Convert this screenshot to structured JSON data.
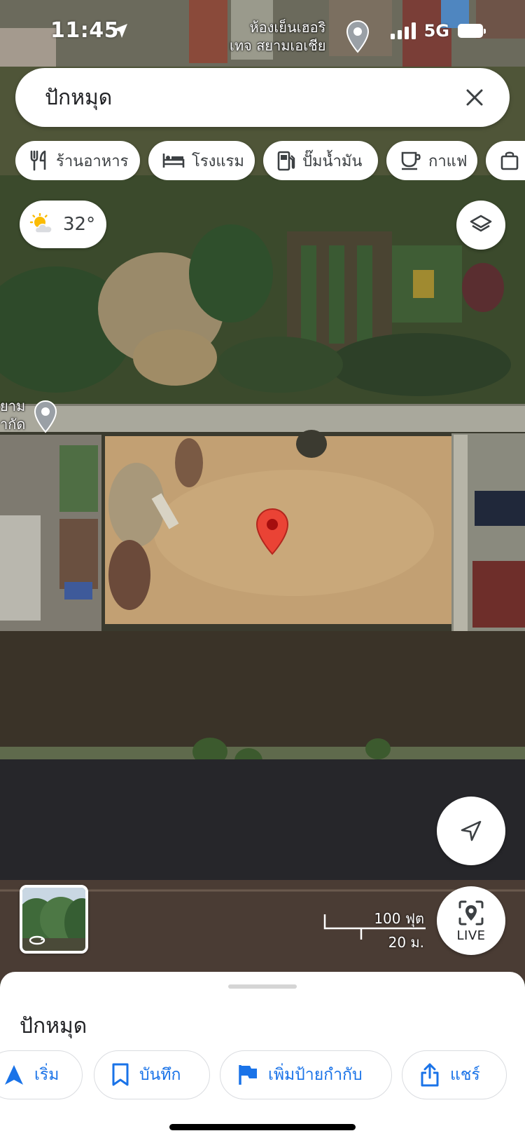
{
  "status_bar": {
    "time": "11:45",
    "network": "5G"
  },
  "map_labels": {
    "place_top_line1": "ห้องเย็นเฮอริ",
    "place_top_line2": "เทจ สยามเอเชีย",
    "place_left_line1": "ยาม",
    "place_left_line2": "ากัด"
  },
  "search": {
    "text": "ปักหมุด"
  },
  "chips": [
    {
      "label": "ร้านอาหาร",
      "icon": "restaurant-icon"
    },
    {
      "label": "โรงแรม",
      "icon": "hotel-icon"
    },
    {
      "label": "ปั๊มน้ำมัน",
      "icon": "gas-station-icon"
    },
    {
      "label": "กาแฟ",
      "icon": "coffee-icon"
    }
  ],
  "weather": {
    "temperature": "32°",
    "icon": "partly-cloudy-icon"
  },
  "live_button": {
    "label": "LIVE"
  },
  "scale": {
    "imperial": "100 ฟุต",
    "metric": "20 ม."
  },
  "sheet": {
    "title": "ปักหมุด",
    "actions": [
      {
        "label": "เริ่ม",
        "icon": "navigation-arrow-icon"
      },
      {
        "label": "บันทึก",
        "icon": "bookmark-icon"
      },
      {
        "label": "เพิ่มป้ายกำกับ",
        "icon": "flag-icon"
      },
      {
        "label": "แชร์",
        "icon": "share-icon"
      }
    ]
  },
  "colors": {
    "accent": "#1a73e8",
    "pin": "#ea4335",
    "pin_dark": "#a50e0e"
  }
}
